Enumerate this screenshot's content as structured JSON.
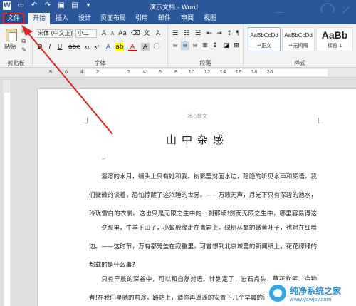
{
  "window": {
    "title": "演示文档 - Word"
  },
  "tabs": [
    {
      "label": "文件"
    },
    {
      "label": "开始"
    },
    {
      "label": "插入"
    },
    {
      "label": "设计"
    },
    {
      "label": "页面布局"
    },
    {
      "label": "引用"
    },
    {
      "label": "邮件"
    },
    {
      "label": "审阅"
    },
    {
      "label": "视图"
    }
  ],
  "ribbon": {
    "clipboard": {
      "paste_label": "粘贴",
      "group_label": "剪贴板"
    },
    "font": {
      "font_name": "宋体 (中文正)",
      "font_size": "小二",
      "group_label": "字体"
    },
    "paragraph": {
      "group_label": "段落"
    },
    "styles": {
      "group_label": "样式",
      "items": [
        {
          "sample": "AaBbCcDd",
          "name": "↵正文"
        },
        {
          "sample": "AaBbCcDd",
          "name": "↵无间隔"
        },
        {
          "sample": "AaBb",
          "name": "标题 1"
        }
      ]
    }
  },
  "ruler": {
    "numbers": [
      "8",
      "6",
      "4",
      "2",
      "",
      "2",
      "4",
      "6",
      "8",
      "10",
      "12",
      "14",
      "16",
      "18",
      "20"
    ]
  },
  "document": {
    "header": "冰心散文",
    "title": "山中杂感",
    "paragraphs": [
      "溶溶的水月，螭头上只有她和我。树影里对面水边，隐隐的听见水声和笑语。我们微微的谈着，恐怕惊醒了这浓睡的世界。——万籁无声，月光下只有深碧的池水，玲珑雪白的衣裳。这也只是无限之生中的一刹那顷!然而无限之生中，哪里容易得这样的一刹那顷!",
      "夕照里，牛羊下山了，小蚁般缘走在青岩上。绿树丛巅的嫩黄叶子，也衬在红墙边。——这时节，万有都笼盖在寂重里，可曾想到北京城里的新闻纸上，花花绿绿的都载的是什么事?",
      "只有早晨的深谷中，可以和自然对语。计划定了，岩石点头，草花欢笑。造物者!在我们星驰的前途，路站上，请你再遥遥的安置下几个早晨的深谷!"
    ]
  },
  "watermark": {
    "text": "纯净系统之家",
    "url": "www.ycwjsy.com"
  }
}
